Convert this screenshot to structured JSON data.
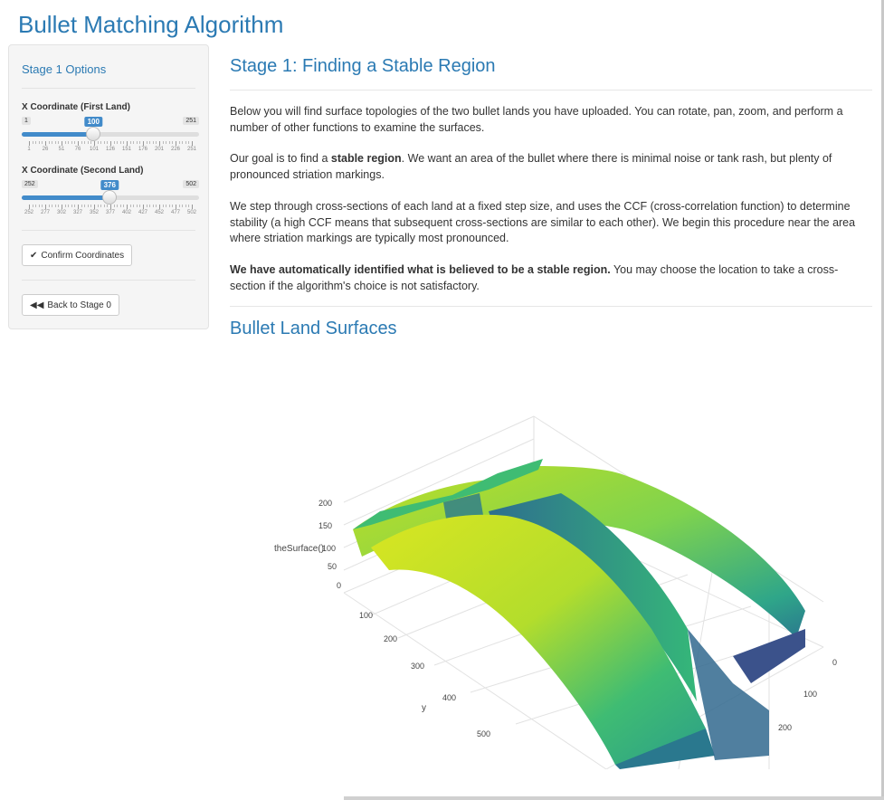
{
  "app": {
    "title": "Bullet Matching Algorithm"
  },
  "sidebar": {
    "title": "Stage 1 Options",
    "slider1": {
      "label": "X Coordinate (First Land)",
      "min": "1",
      "max": "251",
      "value": "100",
      "fraction": 0.396,
      "ticks": [
        "1",
        "26",
        "51",
        "76",
        "101",
        "126",
        "151",
        "176",
        "201",
        "226",
        "251"
      ]
    },
    "slider2": {
      "label": "X Coordinate (Second Land)",
      "min": "252",
      "max": "502",
      "value": "376",
      "fraction": 0.496,
      "ticks": [
        "252",
        "277",
        "302",
        "327",
        "352",
        "377",
        "402",
        "427",
        "452",
        "477",
        "502"
      ]
    },
    "confirm_label": "Confirm Coordinates",
    "confirm_icon": "check-icon",
    "back_label": "Back to Stage 0",
    "back_icon": "double-left-arrow-icon"
  },
  "main": {
    "heading": "Stage 1: Finding a Stable Region",
    "p1": "Below you will find surface topologies of the two bullet lands you have uploaded. You can rotate, pan, zoom, and perform a number of other functions to examine the surfaces.",
    "p2_before": "Our goal is to find a ",
    "p2_bold": "stable region",
    "p2_after": ". We want an area of the bullet where there is minimal noise or tank rash, but plenty of pronounced striation markings.",
    "p3": "We step through cross-sections of each land at a fixed step size, and uses the CCF (cross-correlation function) to determine stability (a high CCF means that subsequent cross-sections are similar to each other). We begin this procedure near the area where striation markings are typically most pronounced.",
    "p4_bold": "We have automatically identified what is believed to be a stable region.",
    "p4_after": " You may choose the location to take a cross-section if the algorithm's choice is not satisfactory.",
    "heading2": "Bullet Land Surfaces"
  },
  "plot": {
    "z_title": "theSurface()",
    "z_ticks": [
      "0",
      "50",
      "100",
      "150",
      "200"
    ],
    "y_title": "y",
    "y_ticks": [
      "100",
      "200",
      "300",
      "400",
      "500"
    ],
    "x_ticks": [
      "0",
      "100",
      "200"
    ],
    "colorscale": [
      "#440154",
      "#3b528b",
      "#21918c",
      "#5ec962",
      "#fde725"
    ]
  }
}
